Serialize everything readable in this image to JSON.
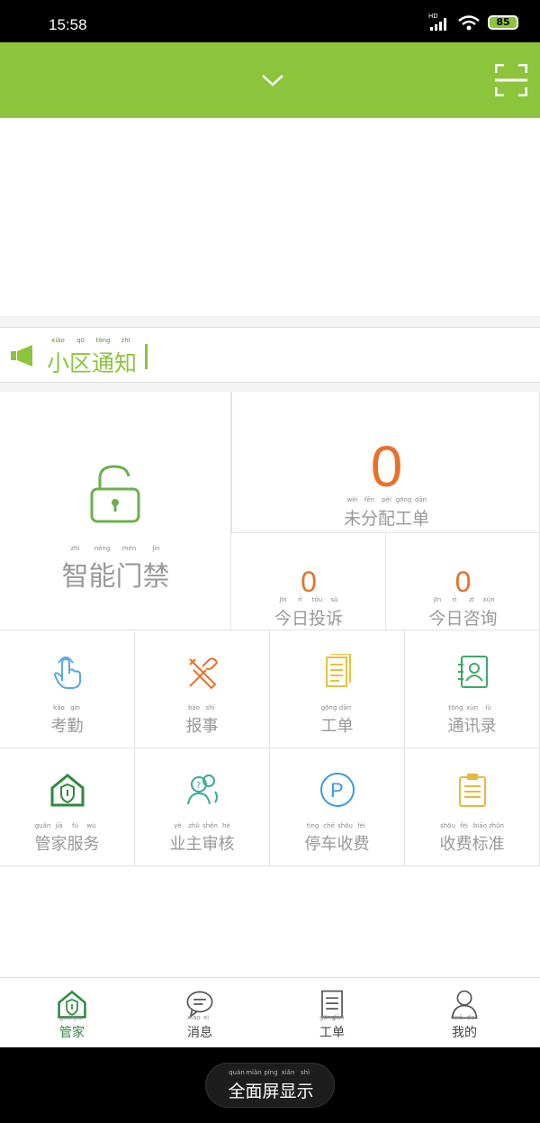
{
  "status": {
    "time": "15:58",
    "signal_tag": "HD",
    "battery": "85",
    "battery_color": "#8cc43c"
  },
  "app": {
    "accent": "#8cc43c",
    "dropdown_icon": "chevron-down-icon",
    "scan_icon": "scan-icon"
  },
  "notice": {
    "title_chars": [
      {
        "char": "小",
        "pinyin": "xiǎo"
      },
      {
        "char": "区",
        "pinyin": "qū"
      },
      {
        "char": "通",
        "pinyin": "tōng"
      },
      {
        "char": "知",
        "pinyin": "zhī"
      }
    ],
    "icon": "megaphone-icon"
  },
  "access": {
    "label_chars": [
      {
        "char": "智",
        "pinyin": "zhì"
      },
      {
        "char": "能",
        "pinyin": "néng"
      },
      {
        "char": "门",
        "pinyin": "mén"
      },
      {
        "char": "禁",
        "pinyin": "jìn"
      }
    ],
    "icon": "unlock-icon"
  },
  "stats": {
    "unassigned": {
      "value": "0",
      "chars": [
        {
          "char": "未",
          "pinyin": "wèi"
        },
        {
          "char": "分",
          "pinyin": "fēn"
        },
        {
          "char": "配",
          "pinyin": "pèi"
        },
        {
          "char": "工",
          "pinyin": "gōng"
        },
        {
          "char": "单",
          "pinyin": "dān"
        }
      ]
    },
    "complaints": {
      "value": "0",
      "chars": [
        {
          "char": "今",
          "pinyin": "jīn"
        },
        {
          "char": "日",
          "pinyin": "rì"
        },
        {
          "char": "投",
          "pinyin": "tóu"
        },
        {
          "char": "诉",
          "pinyin": "sù"
        }
      ]
    },
    "consult": {
      "value": "0",
      "chars": [
        {
          "char": "今",
          "pinyin": "jīn"
        },
        {
          "char": "日",
          "pinyin": "rì"
        },
        {
          "char": "咨",
          "pinyin": "zī"
        },
        {
          "char": "询",
          "pinyin": "xún"
        }
      ]
    },
    "number_color": "#e8702a"
  },
  "services": [
    {
      "icon": "hand-tap-icon",
      "color": "#5aa8e6",
      "chars": [
        {
          "char": "考",
          "pinyin": "kǎo"
        },
        {
          "char": "勤",
          "pinyin": "qín"
        }
      ]
    },
    {
      "icon": "tools-icon",
      "color": "#e8702a",
      "chars": [
        {
          "char": "报",
          "pinyin": "bào"
        },
        {
          "char": "事",
          "pinyin": "shì"
        }
      ]
    },
    {
      "icon": "document-icon",
      "color": "#e8c23c",
      "chars": [
        {
          "char": "工",
          "pinyin": "gōng"
        },
        {
          "char": "单",
          "pinyin": "dān"
        }
      ]
    },
    {
      "icon": "contacts-icon",
      "color": "#3aaa6a",
      "chars": [
        {
          "char": "通",
          "pinyin": "tōng"
        },
        {
          "char": "讯",
          "pinyin": "xùn"
        },
        {
          "char": "录",
          "pinyin": "lù"
        }
      ]
    },
    {
      "icon": "house-shield-icon",
      "color": "#2c8a3c",
      "chars": [
        {
          "char": "管",
          "pinyin": "guǎn"
        },
        {
          "char": "家",
          "pinyin": "jiā"
        },
        {
          "char": "服",
          "pinyin": "fú"
        },
        {
          "char": "务",
          "pinyin": "wù"
        }
      ]
    },
    {
      "icon": "users-question-icon",
      "color": "#3aaa9a",
      "chars": [
        {
          "char": "业",
          "pinyin": "yè"
        },
        {
          "char": "主",
          "pinyin": "zhǔ"
        },
        {
          "char": "审",
          "pinyin": "shěn"
        },
        {
          "char": "核",
          "pinyin": "hé"
        }
      ]
    },
    {
      "icon": "parking-icon",
      "color": "#3a9ae6",
      "chars": [
        {
          "char": "停",
          "pinyin": "tíng"
        },
        {
          "char": "车",
          "pinyin": "chē"
        },
        {
          "char": "收",
          "pinyin": "shōu"
        },
        {
          "char": "费",
          "pinyin": "fèi"
        }
      ]
    },
    {
      "icon": "clipboard-icon",
      "color": "#e8b83c",
      "chars": [
        {
          "char": "收",
          "pinyin": "shōu"
        },
        {
          "char": "费",
          "pinyin": "fèi"
        },
        {
          "char": "标",
          "pinyin": "biāo"
        },
        {
          "char": "准",
          "pinyin": "zhǔn"
        }
      ]
    }
  ],
  "tabs": [
    {
      "icon": "house-shield-icon",
      "active": true,
      "chars": [
        {
          "char": "管",
          "pinyin": "guǎn"
        },
        {
          "char": "家",
          "pinyin": "jiā"
        }
      ]
    },
    {
      "icon": "chat-icon",
      "active": false,
      "chars": [
        {
          "char": "消",
          "pinyin": "xiāo"
        },
        {
          "char": "息",
          "pinyin": "xi"
        }
      ]
    },
    {
      "icon": "list-icon",
      "active": false,
      "chars": [
        {
          "char": "工",
          "pinyin": "gōng"
        },
        {
          "char": "单",
          "pinyin": "dān"
        }
      ]
    },
    {
      "icon": "user-icon",
      "active": false,
      "chars": [
        {
          "char": "我",
          "pinyin": "wǒ"
        },
        {
          "char": "的",
          "pinyin": "de"
        }
      ]
    }
  ],
  "tab_active_color": "#2c8a3c",
  "system": {
    "fullscreen_chars": [
      {
        "char": "全",
        "pinyin": "quán"
      },
      {
        "char": "面",
        "pinyin": "miàn"
      },
      {
        "char": "屏",
        "pinyin": "píng"
      },
      {
        "char": "显",
        "pinyin": "xiǎn"
      },
      {
        "char": "示",
        "pinyin": "shì"
      }
    ]
  }
}
